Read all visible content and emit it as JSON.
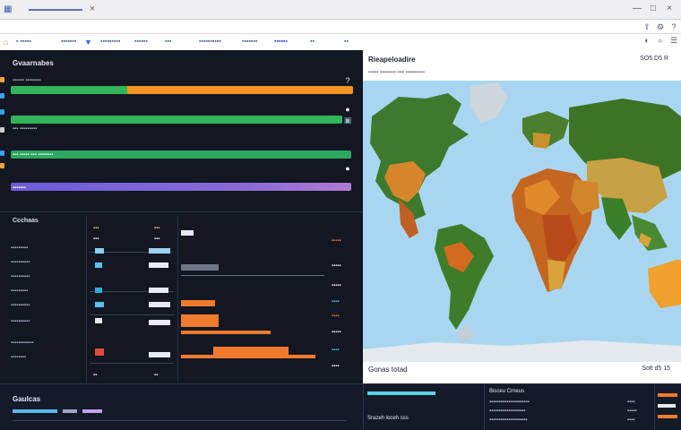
{
  "window": {
    "favicon_icon": "grid-icon",
    "close_glyph": "×",
    "controls": [
      "—",
      "□",
      "×"
    ]
  },
  "toolbar_icons": [
    "share-icon",
    "settings-icon",
    "help-icon",
    "menu-icon"
  ],
  "nav": {
    "items": [
      {
        "label": "▪ ▪▪▪▪▪",
        "active": false
      },
      {
        "label": "▪▪▪▪▪▪▪",
        "active": false
      },
      {
        "label": "▪▪▪▪▪▪▪▪▪",
        "active": false
      },
      {
        "label": "▪▪▪▪▪▪",
        "active": false
      },
      {
        "label": "▪▪▪",
        "active": false
      },
      {
        "label": "▪▪▪▪▪▪▪▪▪▪",
        "active": false
      },
      {
        "label": "▪▪▪▪▪▪▪",
        "active": false
      },
      {
        "label": "▪▪▪▪▪▪",
        "active": true
      },
      {
        "label": "▪▪",
        "active": false
      }
    ]
  },
  "left_panel": {
    "title": "Gvaarnabes",
    "rows": [
      {
        "label": "▪▪▪▪▪▪ ▪▪▪▪▪▪▪▪",
        "progress": 0.34,
        "icon": "?"
      },
      {
        "label": "▪▪▪▪▪▪▪▪ ▪▪▪▪▪",
        "progress": 1.0,
        "icon": "●"
      },
      {
        "label": "▪▪▪ ▪▪▪▪▪▪▪▪▪",
        "progress": 0.97,
        "icon": "▣"
      },
      {
        "label": "▪▪▪ ▪▪▪▪▪ ▪▪▪ ▪▪▪▪▪▪▪▪",
        "progress": 1.0,
        "icon": "●"
      },
      {
        "label": "▪▪▪▪▪▪▪",
        "progress": 1.0,
        "icon": ""
      }
    ],
    "lower_title": "Ccchaas",
    "lower_rows": [
      "▪▪▪▪▪▪▪▪▪",
      "▪▪▪▪▪▪▪▪▪▪",
      "▪▪▪▪▪▪▪▪▪▪",
      "▪▪▪▪▪▪▪▪▪",
      "▪▪▪▪▪▪▪▪▪▪",
      "▪▪▪▪▪▪▪▪▪▪",
      "▪▪▪▪▪▪▪▪▪▪▪▪",
      "▪▪▪▪▪▪▪▪"
    ],
    "col_values_a": [
      "▪▪▪",
      "▪▪▪",
      "▪▪",
      "▪▪",
      "▪▪",
      "▪▪",
      "▪▪▪",
      "▪▪"
    ],
    "col_values_b": [
      "▪▪▪",
      "▪▪▪",
      "▪▪",
      "▪▪",
      "▪▪",
      "▪▪",
      "▪▪▪",
      "▪▪"
    ],
    "right_values": [
      "▪▪▪▪▪",
      "▪▪▪▪▪",
      "▪▪▪▪▪",
      "▪▪▪▪",
      "▪▪▪▪",
      "▪▪▪▪▪",
      "▪▪▪▪",
      "▪▪▪▪"
    ]
  },
  "map_panel": {
    "title": "Rieapeloadire",
    "subtitle": "▪▪▪▪▪▪ ▪▪▪▪▪▪▪▪▪ ▪▪▪▪ ▪▪▪▪▪▪▪▪▪▪▪",
    "controls": "SO5 D5  R",
    "footer_left": "Gonas totad",
    "footer_right": "Sotl d5  15"
  },
  "bottom": {
    "title": "Gaulcas",
    "mid_text": "Srazeh  loceh sss",
    "right_title": "Bisceu Crneus",
    "right_rows": [
      "▪▪▪▪▪▪▪▪▪▪▪▪▪▪▪▪▪▪▪▪▪",
      "▪▪▪▪▪▪▪▪▪▪▪▪▪▪▪▪▪▪▪",
      "▪▪▪▪▪▪▪▪▪▪▪▪▪▪▪▪▪▪▪▪"
    ],
    "far_rows": [
      "▪▪▪▪",
      "▪▪▪▪▪",
      "▪▪▪▪"
    ]
  },
  "colors": {
    "green": "#31b45a",
    "orange": "#f39321",
    "purple": "#7b62d8",
    "ocean": "#a8d6f0",
    "panel_dark": "#121722"
  }
}
